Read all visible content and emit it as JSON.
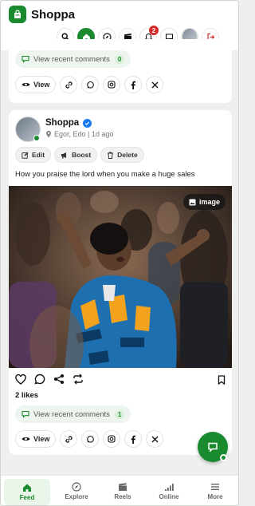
{
  "app": {
    "name": "Shoppa",
    "accent": "#1a8a2e"
  },
  "header": {
    "icons": [
      "search-icon",
      "home-icon",
      "compass-icon",
      "clapperboard-icon",
      "bell-icon",
      "chat-icon",
      "avatar",
      "logout-icon"
    ],
    "notification_count": "2"
  },
  "previous_post": {
    "comments_label": "View recent comments",
    "comments_count": "0",
    "view_label": "View"
  },
  "post": {
    "author": "Shoppa",
    "verified": true,
    "location": "Egor, Edo",
    "time": "1d ago",
    "actions": {
      "edit": "Edit",
      "boost": "Boost",
      "delete": "Delete"
    },
    "caption": "How you praise the lord when you make a huge sales",
    "image_tag": "image",
    "likes": "2 likes",
    "comments_label": "View recent comments",
    "comments_count": "1",
    "view_label": "View"
  },
  "bottom_nav": {
    "items": [
      {
        "label": "Feed",
        "icon": "home-icon",
        "active": true
      },
      {
        "label": "Explore",
        "icon": "compass-icon",
        "active": false
      },
      {
        "label": "Reels",
        "icon": "clapperboard-icon",
        "active": false
      },
      {
        "label": "Online",
        "icon": "signal-icon",
        "active": false
      },
      {
        "label": "More",
        "icon": "menu-icon",
        "active": false
      }
    ]
  }
}
